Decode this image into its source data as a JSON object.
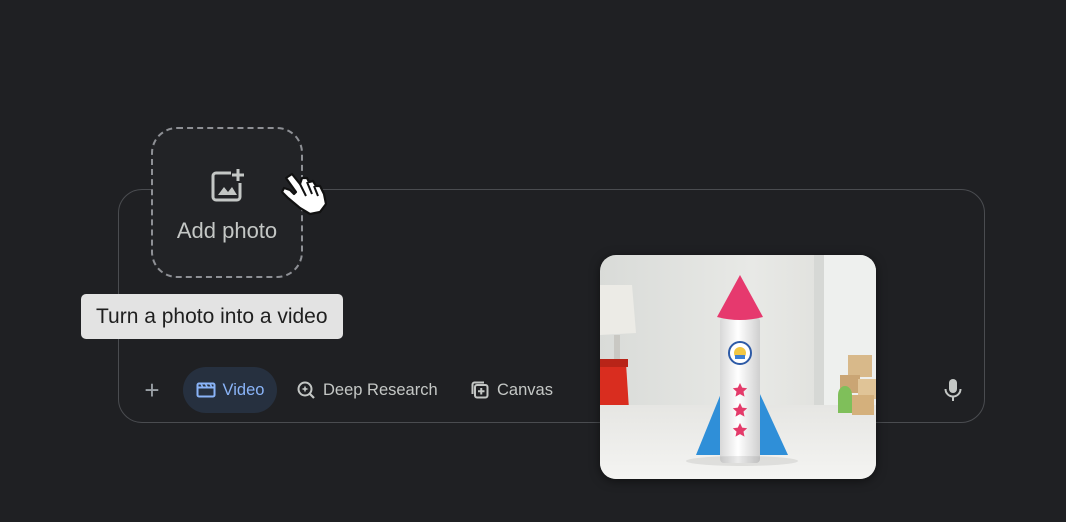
{
  "add_photo": {
    "label": "Add photo",
    "icon": "add-photo-icon"
  },
  "tooltip": {
    "text": "Turn a photo into a video"
  },
  "toolbar": {
    "plus_icon": "plus-icon",
    "plus_glyph": "+",
    "chips": [
      {
        "label": "Video",
        "icon": "video-icon",
        "active": true
      },
      {
        "label": "Deep Research",
        "icon": "deep-research-icon",
        "active": false
      },
      {
        "label": "Canvas",
        "icon": "canvas-icon",
        "active": false
      }
    ],
    "mic_icon": "microphone-icon"
  },
  "preview": {
    "subject": "paper-rocket-photo"
  },
  "colors": {
    "background": "#1f2023",
    "active_chip_bg": "#26303f",
    "active_chip_text": "#8ab4f8",
    "text_muted": "#c4c7c5",
    "tooltip_bg": "#e3e3e3"
  }
}
